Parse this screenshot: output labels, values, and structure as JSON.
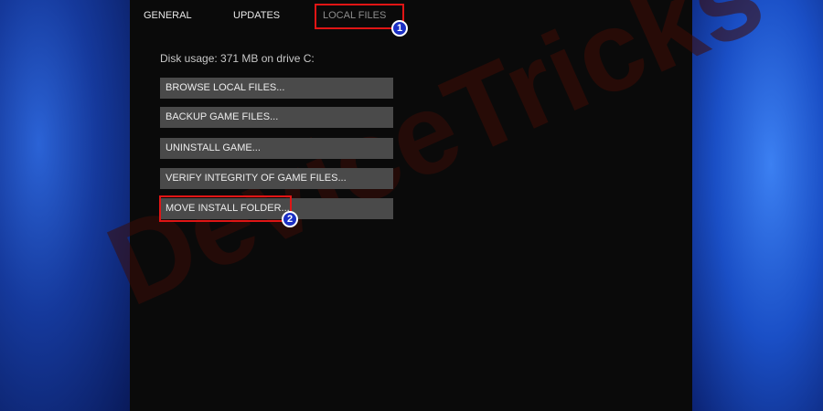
{
  "tabs": [
    {
      "label": "GENERAL"
    },
    {
      "label": "UPDATES"
    },
    {
      "label": "LOCAL FILES"
    }
  ],
  "disk_usage": "Disk usage: 371 MB on drive C:",
  "buttons": [
    {
      "label": "BROWSE LOCAL FILES..."
    },
    {
      "label": "BACKUP GAME FILES..."
    },
    {
      "label": "UNINSTALL GAME..."
    },
    {
      "label": "VERIFY INTEGRITY OF GAME FILES..."
    },
    {
      "label": "MOVE INSTALL FOLDER..."
    }
  ],
  "annotations": [
    {
      "number": "1",
      "color": "#e01515"
    },
    {
      "number": "2",
      "color": "#e01515"
    }
  ],
  "watermark": {
    "prefix": "Device",
    "suffix": "Tricks"
  },
  "colors": {
    "panel": "#0a0a0a",
    "button": "#4a4a4a",
    "highlight": "#e01515",
    "badge": "#1b2fc4"
  }
}
